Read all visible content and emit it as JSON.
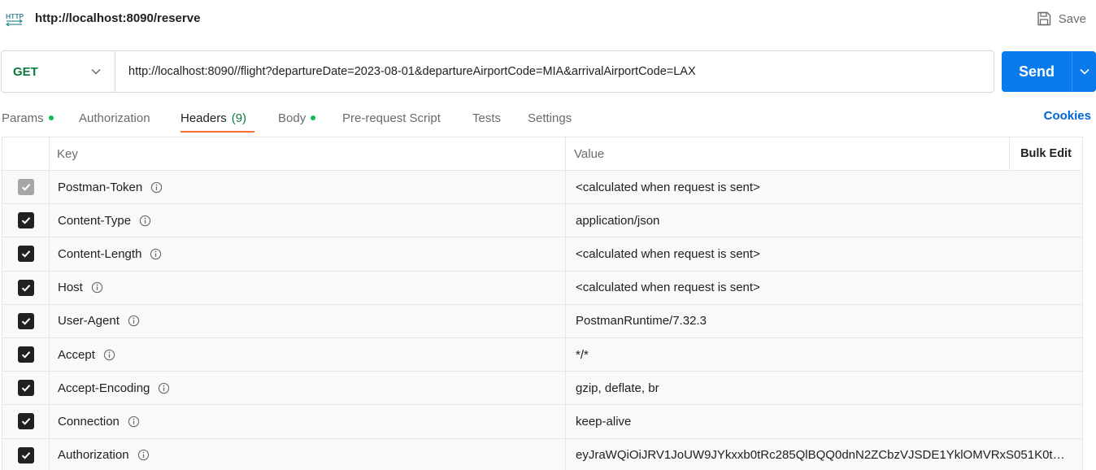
{
  "header": {
    "icon": "http-icon",
    "title": "http://localhost:8090/reserve",
    "save_label": "Save"
  },
  "request": {
    "method": "GET",
    "url": "http://localhost:8090//flight?departureDate=2023-08-01&departureAirportCode=MIA&arrivalAirportCode=LAX",
    "send_label": "Send"
  },
  "tabs": {
    "params": "Params",
    "authorization": "Authorization",
    "headers": "Headers",
    "headers_count": "(9)",
    "body": "Body",
    "prerequest": "Pre-request Script",
    "tests": "Tests",
    "settings": "Settings",
    "cookies": "Cookies",
    "active": "Headers"
  },
  "table": {
    "col_key": "Key",
    "col_value": "Value",
    "bulk_edit": "Bulk Edit",
    "rows": [
      {
        "key": "Postman-Token",
        "value": "<calculated when request is sent>",
        "checked": true,
        "disabled": true
      },
      {
        "key": "Content-Type",
        "value": "application/json",
        "checked": true,
        "disabled": false
      },
      {
        "key": "Content-Length",
        "value": "<calculated when request is sent>",
        "checked": true,
        "disabled": false
      },
      {
        "key": "Host",
        "value": "<calculated when request is sent>",
        "checked": true,
        "disabled": false
      },
      {
        "key": "User-Agent",
        "value": "PostmanRuntime/7.32.3",
        "checked": true,
        "disabled": false
      },
      {
        "key": "Accept",
        "value": "*/*",
        "checked": true,
        "disabled": false
      },
      {
        "key": "Accept-Encoding",
        "value": "gzip, deflate, br",
        "checked": true,
        "disabled": false
      },
      {
        "key": "Connection",
        "value": "keep-alive",
        "checked": true,
        "disabled": false
      },
      {
        "key": "Authorization",
        "value": "eyJraWQiOiJRV1JoUW9JYkxxb0tRc285QlBQQ0dnN2ZCbzVJSDE1YklOMVRxS051K0t…",
        "checked": true,
        "disabled": false
      }
    ]
  },
  "colors": {
    "accent": "#ff6c37",
    "send": "#097bed",
    "method": "#0b7a3e",
    "status_dot": "#0cbb52",
    "link": "#0265d2"
  }
}
